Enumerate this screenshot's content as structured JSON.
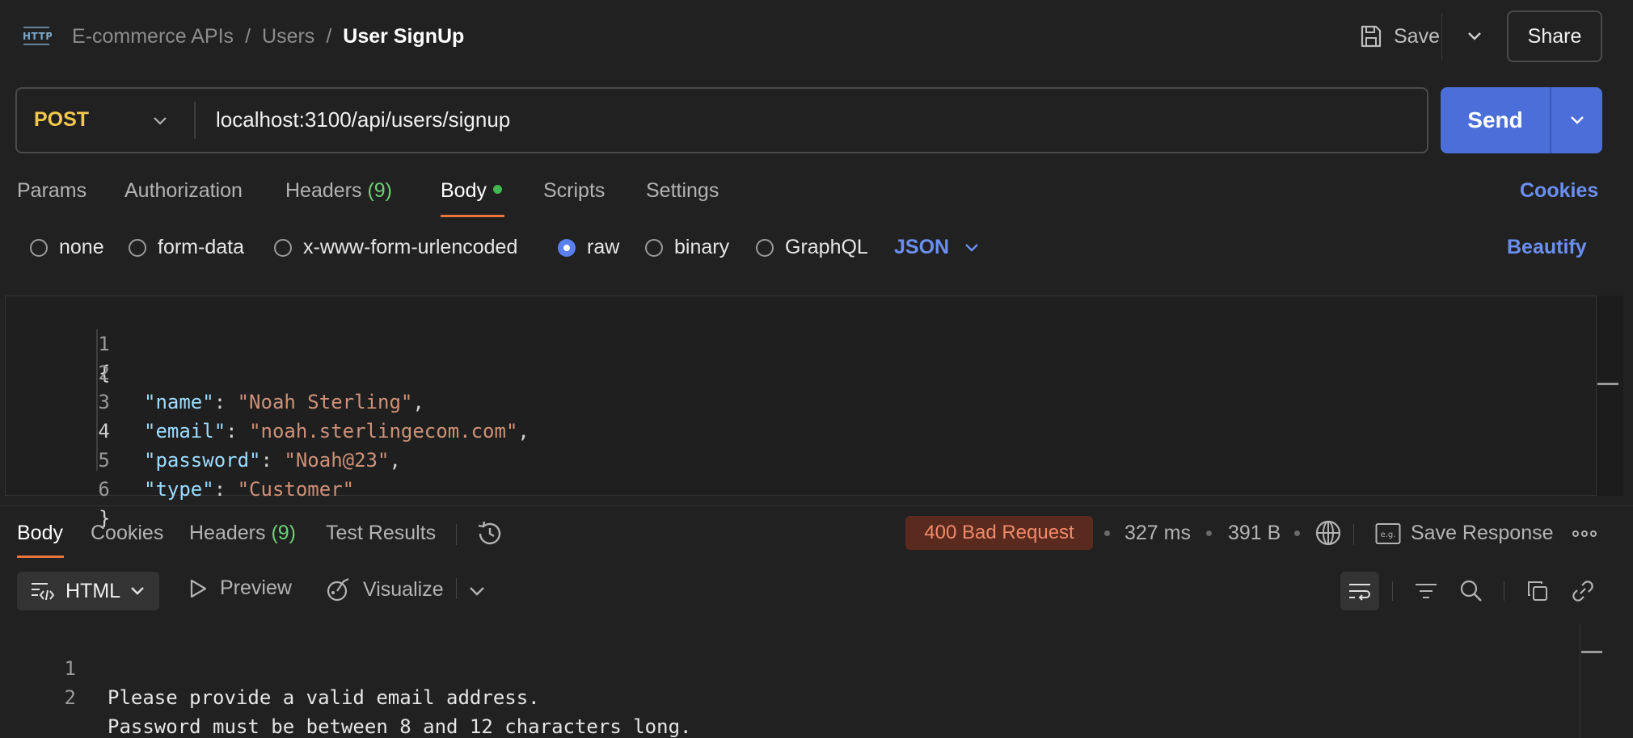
{
  "header": {
    "breadcrumb": [
      "E-commerce APIs",
      "Users"
    ],
    "separator": "/",
    "current": "User SignUp",
    "save_label": "Save",
    "share_label": "Share"
  },
  "request": {
    "method": "POST",
    "url": "localhost:3100/api/users/signup",
    "send_label": "Send"
  },
  "request_tabs": {
    "params": "Params",
    "authorization": "Authorization",
    "headers": "Headers",
    "headers_count": "(9)",
    "body": "Body",
    "scripts": "Scripts",
    "settings": "Settings",
    "cookies": "Cookies"
  },
  "body_types": {
    "options": [
      "none",
      "form-data",
      "x-www-form-urlencoded",
      "raw",
      "binary",
      "GraphQL"
    ],
    "selected": "raw",
    "format": "JSON",
    "beautify": "Beautify"
  },
  "editor": {
    "line_numbers": [
      "1",
      "2",
      "3",
      "4",
      "5",
      "6"
    ],
    "open_brace": "{",
    "close_brace": "}",
    "fields": [
      {
        "key": "\"name\"",
        "value": "\"Noah Sterling\"",
        "comma": ","
      },
      {
        "key": "\"email\"",
        "value": "\"noah.sterlingecom.com\"",
        "comma": ","
      },
      {
        "key": "\"password\"",
        "value": "\"Noah@23\"",
        "comma": ","
      },
      {
        "key": "\"type\"",
        "value": "\"Customer\"",
        "comma": ""
      }
    ],
    "colon": ": "
  },
  "response_tabs": {
    "body": "Body",
    "cookies": "Cookies",
    "headers": "Headers",
    "headers_count": "(9)",
    "test_results": "Test Results"
  },
  "response_meta": {
    "status": "400 Bad Request",
    "time": "327 ms",
    "size": "391 B",
    "save_response": "Save Response",
    "eg_label": "e.g."
  },
  "response_toolbar": {
    "format": "HTML",
    "preview": "Preview",
    "visualize": "Visualize"
  },
  "response_body": {
    "line_numbers": [
      "1",
      "2"
    ],
    "lines": [
      "Please provide a valid email address.",
      "Password must be between 8 and 12 characters long."
    ]
  },
  "colors": {
    "accent": "#4b6ed8",
    "link": "#6b8ff0",
    "method": "#f2c94c",
    "error_badge_bg": "#5a2a1e",
    "error_badge_text": "#f08a6a",
    "tab_underline": "#e8743b",
    "dot_green": "#3fb950"
  },
  "icons": {
    "http": "http-icon",
    "save": "save-icon",
    "history": "history-icon",
    "globe": "globe-icon",
    "more": "more-icon"
  }
}
